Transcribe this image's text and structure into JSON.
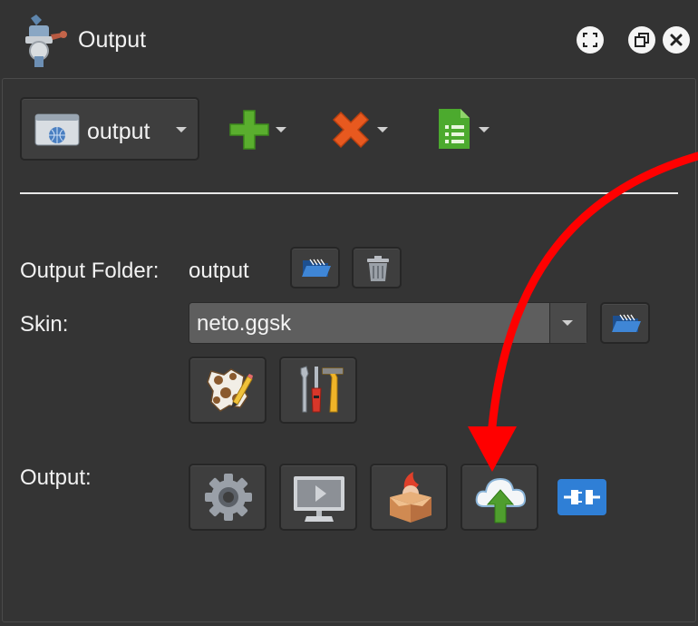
{
  "window": {
    "title": "Output",
    "icons": {
      "app": "meat-grinder-icon",
      "fullscreen": "fullscreen-icon",
      "restore": "restore-window-icon",
      "close": "close-icon"
    }
  },
  "toolbar": {
    "output_selector": {
      "value": "output",
      "icon": "browser-window-icon"
    },
    "add_icon": "add-plus-icon",
    "delete_icon": "delete-x-icon",
    "document_icon": "document-list-icon"
  },
  "output_folder": {
    "label": "Output Folder:",
    "value": "output",
    "icons": [
      "open-folder-icon",
      "trash-icon"
    ]
  },
  "skin": {
    "label": "Skin:",
    "value": "neto.ggsk",
    "icons": [
      "open-folder-icon",
      "skin-editor-icon",
      "tools-icon"
    ]
  },
  "output_section": {
    "label": "Output:",
    "icons": [
      "settings-gear-icon",
      "preview-monitor-icon",
      "package-box-icon",
      "cloud-upload-icon",
      "plugin-connect-icon"
    ]
  },
  "annotation": {
    "type": "red-arrow",
    "color": "#ff0000",
    "points_to": "cloud-upload-button"
  },
  "colors": {
    "background": "#343434",
    "button": "#3e3e3e",
    "input": "#5e5e5e",
    "arrow": "#ff0000"
  }
}
